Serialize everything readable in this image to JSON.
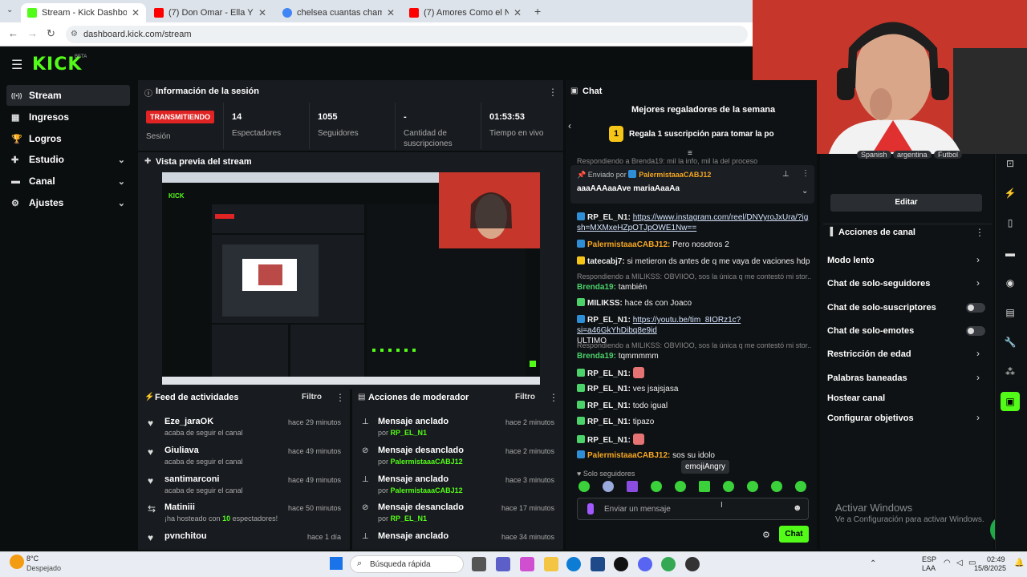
{
  "browser": {
    "tabs": [
      {
        "title": "Stream - Kick Dashboard",
        "active": true,
        "favicon_color": "#53fc18"
      },
      {
        "title": "(7) Don Omar - Ella Y Yo ft. Ro",
        "active": false,
        "favicon_color": "#ff0000"
      },
      {
        "title": "chelsea cuantas champions - B",
        "active": false,
        "favicon_color": "#4285f4"
      },
      {
        "title": "(7) Amores Como el Nuestro - Y",
        "active": false,
        "favicon_color": "#ff0000"
      }
    ],
    "new_tab": "+",
    "url": "dashboard.kick.com/stream"
  },
  "header": {
    "logo": "KICK",
    "beta": "BETA"
  },
  "sidebar": {
    "items": [
      {
        "label": "Stream",
        "icon": "stream-icon",
        "glyph": "((•))",
        "active": true,
        "chevron": false
      },
      {
        "label": "Ingresos",
        "icon": "money-icon",
        "glyph": "▦",
        "active": false,
        "chevron": false
      },
      {
        "label": "Logros",
        "icon": "trophy-icon",
        "glyph": "🏆",
        "active": false,
        "chevron": false
      },
      {
        "label": "Estudio",
        "icon": "studio-icon",
        "glyph": "✚",
        "active": false,
        "chevron": true
      },
      {
        "label": "Canal",
        "icon": "channel-icon",
        "glyph": "▬",
        "active": false,
        "chevron": true
      },
      {
        "label": "Ajustes",
        "icon": "gear-icon",
        "glyph": "⚙",
        "active": false,
        "chevron": true
      }
    ]
  },
  "session": {
    "title": "Información de la sesión",
    "status_badge": "TRANSMITIENDO",
    "status_label": "Sesión",
    "stats": [
      {
        "value": "14",
        "label": "Espectadores"
      },
      {
        "value": "1055",
        "label": "Seguidores"
      },
      {
        "value": "-",
        "label": "Cantidad de suscripciones"
      },
      {
        "value": "01:53:53",
        "label": "Tiempo en vivo"
      }
    ]
  },
  "preview": {
    "title": "Vista previa del stream"
  },
  "feed": {
    "title": "Feed de actividades",
    "filter": "Filtro",
    "rows": [
      {
        "name": "Eze_jaraOK",
        "sub": "acaba de seguir el canal",
        "time": "hace 29 minutos",
        "icon": "heart-icon",
        "glyph": "♥"
      },
      {
        "name": "Giuliava",
        "sub": "acaba de seguir el canal",
        "time": "hace 49 minutos",
        "icon": "heart-icon",
        "glyph": "♥"
      },
      {
        "name": "santimarconi",
        "sub": "acaba de seguir el canal",
        "time": "hace 49 minutos",
        "icon": "heart-icon",
        "glyph": "♥"
      },
      {
        "name": "Matiniii",
        "sub_pre": "¡ha hosteado con ",
        "sub_num": "10",
        "sub_post": " espectadores!",
        "time": "hace 50 minutos",
        "icon": "host-icon",
        "glyph": "⇆"
      },
      {
        "name": "pvnchitou",
        "sub": "",
        "time": "hace 1 día",
        "icon": "heart-icon",
        "glyph": "♥"
      }
    ]
  },
  "modactions": {
    "title": "Acciones de moderador",
    "filter": "Filtro",
    "rows": [
      {
        "action": "Mensaje anclado",
        "by": "por",
        "user": "RP_EL_N1",
        "time": "hace 2 minutos",
        "icon": "pin-icon",
        "glyph": "📌"
      },
      {
        "action": "Mensaje desanclado",
        "by": "por",
        "user": "PalermistaaaCABJ12",
        "time": "hace 2 minutos",
        "icon": "unpin-icon",
        "glyph": "✂"
      },
      {
        "action": "Mensaje anclado",
        "by": "por",
        "user": "PalermistaaaCABJ12",
        "time": "hace 3 minutos",
        "icon": "pin-icon",
        "glyph": "📌"
      },
      {
        "action": "Mensaje desanclado",
        "by": "por",
        "user": "RP_EL_N1",
        "time": "hace 17 minutos",
        "icon": "unpin-icon",
        "glyph": "✂"
      },
      {
        "action": "Mensaje anclado",
        "by": "por",
        "user": "",
        "time": "hace 34 minutos",
        "icon": "pin-icon",
        "glyph": "📌"
      }
    ]
  },
  "chat": {
    "title": "Chat",
    "gifters_title": "Mejores regaladores de la semana",
    "gift_cta": "Regala 1 suscripción para tomar la po",
    "gift_rank": "1",
    "reply_top": "Respondiendo a Brenda19: mil la info, mil la del proceso",
    "pinned": {
      "label": "Enviado por",
      "user": "PalermistaaaCABJ12",
      "text": "aaaAAAaaAve mariaAaaAa"
    },
    "messages": [
      {
        "user": "RP_EL_N1:",
        "text": "https://www.instagram.com/reel/DNVyroJxUra/?igsh=MXMxeHZpOTJpOWE1Nw==",
        "color": "#ffffff",
        "link": true
      },
      {
        "user": "PalermistaaaCABJ12:",
        "text": "Pero nosotros 2",
        "color": "#f5a623"
      },
      {
        "user": "tatecabj7:",
        "text": "si metieron ds antes de q me vaya de vaciones hdp",
        "color": "#ffffff"
      },
      {
        "reply": "Respondiendo a MILIKSS: OBVIIOO, sos la única q me contestó mi stor..."
      },
      {
        "user": "Brenda19:",
        "text": "también",
        "color": "#4bd26b"
      },
      {
        "user": "MILIKSS:",
        "text": "hace ds con Joaco",
        "color": "#ffffff"
      },
      {
        "user": "RP_EL_N1:",
        "text": "https://youtu.be/tim_8IORz1c?si=a46GkYhDibq8e9id",
        "text2": "ULTIMO",
        "color": "#ffffff",
        "link": true
      },
      {
        "reply": "Respondiendo a MILIKSS: OBVIIOO, sos la única q me contestó mi stor..."
      },
      {
        "user": "Brenda19:",
        "text": "tqmmmmm",
        "color": "#4bd26b"
      },
      {
        "user": "RP_EL_N1:",
        "text": "",
        "color": "#ffffff",
        "emote": true
      },
      {
        "user": "RP_EL_N1:",
        "text": "ves jsajsjasa",
        "color": "#ffffff"
      },
      {
        "user": "RP_EL_N1:",
        "text": "todo igual",
        "color": "#ffffff"
      },
      {
        "user": "RP_EL_N1:",
        "text": "tipazo",
        "color": "#ffffff"
      },
      {
        "user": "RP_EL_N1:",
        "text": "",
        "color": "#ffffff",
        "emote": true
      },
      {
        "user": "PalermistaaaCABJ12:",
        "text": "sos su idolo",
        "color": "#f5a623"
      }
    ],
    "followers_only": "Solo seguidores",
    "tooltip": "emojiAngry",
    "input_placeholder": "Enviar un mensaje",
    "send_label": "Chat"
  },
  "channel_panel": {
    "tags": [
      "Spanish",
      "argentina",
      "Futbol"
    ],
    "edit_label": "Editar",
    "title": "Acciones de canal",
    "items": [
      {
        "label": "Modo lento",
        "type": "chevron"
      },
      {
        "label": "Chat de solo-seguidores",
        "type": "chevron"
      },
      {
        "label": "Chat de solo-suscriptores",
        "type": "toggle"
      },
      {
        "label": "Chat de solo-emotes",
        "type": "toggle"
      },
      {
        "label": "Restricción de edad",
        "type": "chevron"
      },
      {
        "label": "Palabras baneadas",
        "type": "chevron"
      },
      {
        "label": "Hostear canal",
        "type": "none"
      },
      {
        "label": "Configurar objetivos",
        "type": "chevron"
      }
    ],
    "activate_title": "Activar Windows",
    "activate_sub": "Ve a Configuración para activar Windows."
  },
  "taskbar": {
    "weather_temp": "8°C",
    "weather_desc": "Despejado",
    "search": "Búsqueda rápida",
    "lang1": "ESP",
    "lang2": "LAA",
    "time": "02:49",
    "date": "15/8/2025"
  }
}
